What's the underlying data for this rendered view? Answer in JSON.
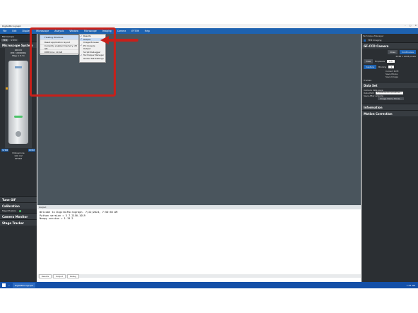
{
  "window": {
    "title": "DigitalMicrograph"
  },
  "menubar": [
    "File",
    "Edit",
    "Display",
    "Microscope",
    "Analysis",
    "Window",
    "Microscope",
    "Imaging",
    "Camera",
    "EFTEM",
    "Help"
  ],
  "menu_window": [
    "Floating Windows",
    "Reset application layout",
    "Currently enabled memory: 28 GB",
    "DPB time: 10 GB"
  ],
  "menu_floating": [
    {
      "label": "Results",
      "checked": true
    },
    {
      "label": "Output",
      "checked": true,
      "highlight": true
    },
    {
      "label": "Image Browser",
      "checked": false
    },
    {
      "label": "PS Console",
      "checked": true
    },
    {
      "label": "Output",
      "checked": false
    },
    {
      "label": "Script Debugger",
      "checked": false
    },
    {
      "label": "Technique Manager",
      "checked": true
    },
    {
      "label": "Global Tab Settings",
      "checked": false
    }
  ],
  "left_panel": {
    "header": "Microscope",
    "tabs": [
      "TEM",
      "STEM"
    ],
    "section_title": "Microscope System",
    "scope_values": [
      "200 kV",
      "WD: 1000000x",
      "Mag: x 0.7x"
    ],
    "side_labels": [
      "STEM",
      "STEM"
    ],
    "bottom_values": [
      "Hollowcone",
      "100 mV"
    ],
    "bottom_label": "EFTEM",
    "sections": [
      "Tune GIF",
      "Calibration",
      "Camera Monitor",
      "Stage Tracker"
    ],
    "calibration_label": "Magnification"
  },
  "output": {
    "header": "Output",
    "lines": [
      "Welcome to DigitalMicrograph.  7/22/2024, 7:50:56 AM",
      "Python version = 3.7.2150.1019",
      "Numpy version = 1.19.2"
    ],
    "tabs": [
      "Results",
      "Output",
      "Debug"
    ]
  },
  "right_panel": {
    "header": "Technique Manager",
    "mode": "TEM Imaging",
    "section_camera": "GF-CCD Camera",
    "view_label": "View",
    "capture_label": "Capture",
    "close_label": "Close",
    "continuous_label": "Continuous",
    "size_text": "2048 x 2048 pixels",
    "exposure_label": "Exposure",
    "exposure_value": "0.5",
    "binning_label": "Binning",
    "binning_value": "1",
    "frames_label": "Frames",
    "checks": [
      "Correct Drift",
      "Save Movie",
      "Save Image"
    ],
    "section_data": "Data Set",
    "data_subtitle": "Camera data save",
    "data_field_label": "Data Path",
    "data_field_value": "C:\\Users\\Admin\\OneDrive...",
    "save_check": "Save After Acquire",
    "new_button": "Image Name Mode...",
    "sections": [
      "Information",
      "Motion Correction"
    ]
  },
  "taskbar": {
    "app": "DigitalMicrograph",
    "time": "7:51 AM"
  },
  "colors": {
    "accent": "#1e62b0",
    "highlight_box": "#c8201a",
    "workspace": "#4a555d"
  }
}
